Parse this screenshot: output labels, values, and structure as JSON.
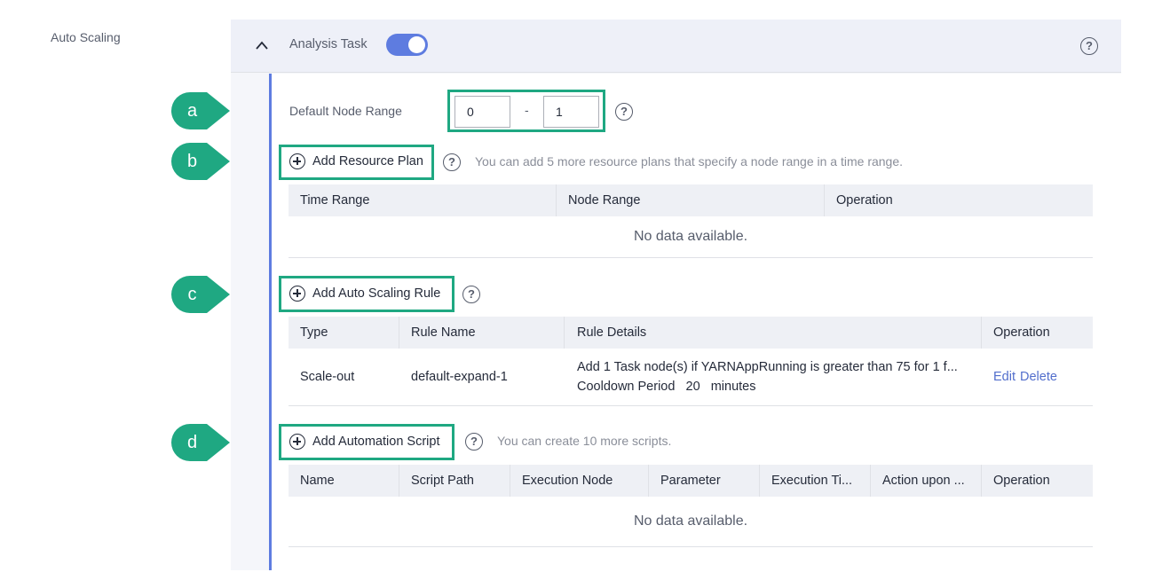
{
  "side_label": "Auto Scaling",
  "header": {
    "title": "Analysis Task",
    "toggle_on": true,
    "help": "?"
  },
  "markers": [
    "a",
    "b",
    "c",
    "d"
  ],
  "node_range": {
    "label": "Default Node Range",
    "min": "0",
    "separator": "-",
    "max": "1",
    "help": "?"
  },
  "resource_plan": {
    "button": "Add Resource Plan",
    "help": "?",
    "hint": "You can add 5 more resource plans that specify a node range in a time range.",
    "columns": [
      "Time Range",
      "Node Range",
      "Operation"
    ],
    "empty": "No data available."
  },
  "scaling_rule": {
    "button": "Add Auto Scaling Rule",
    "help": "?",
    "columns": [
      "Type",
      "Rule Name",
      "Rule Details",
      "Operation"
    ],
    "rows": [
      {
        "type": "Scale-out",
        "rule_name": "default-expand-1",
        "details_line1": "Add 1 Task node(s) if YARNAppRunning is greater than 75 for 1 f...",
        "details_line2": "Cooldown Period   20   minutes",
        "edit": "Edit",
        "delete": "Delete"
      }
    ]
  },
  "automation_script": {
    "button": "Add Automation Script",
    "help": "?",
    "hint": "You can create 10 more scripts.",
    "columns": [
      "Name",
      "Script Path",
      "Execution Node",
      "Parameter",
      "Execution Ti...",
      "Action upon ...",
      "Operation"
    ],
    "empty": "No data available."
  },
  "colors": {
    "accent": "#5e7ce0",
    "highlight": "#1fa882",
    "link": "#526ecc"
  }
}
